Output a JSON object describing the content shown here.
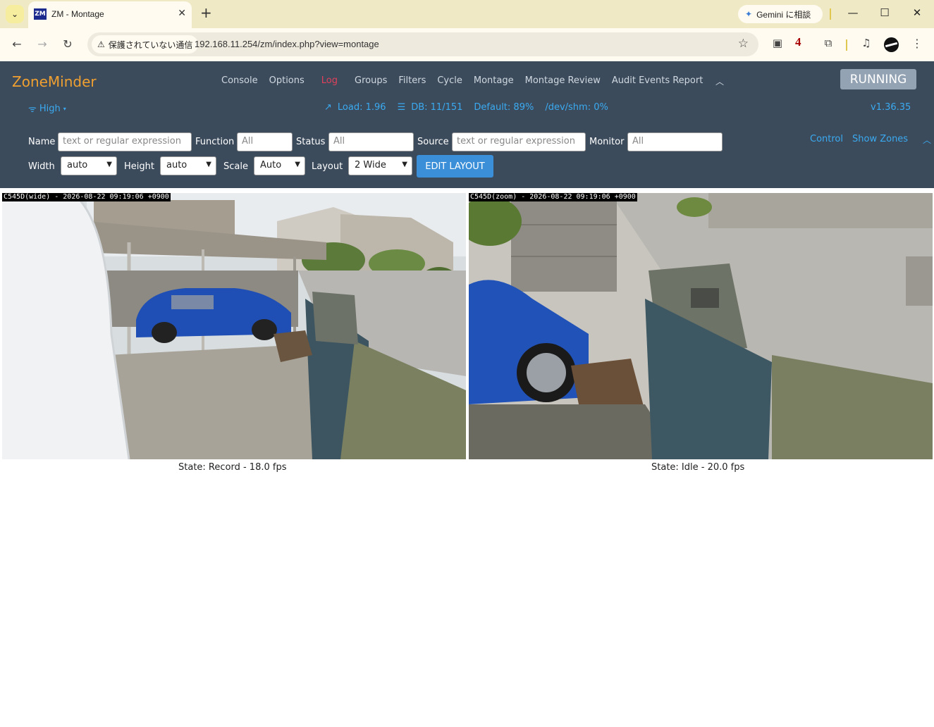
{
  "browser": {
    "tab_title": "ZM - Montage",
    "tab_favicon": "ZM",
    "gemini_label": "Gemini に相談",
    "security_label": "保護されていない通信",
    "url": "192.168.11.254/zm/index.php?view=montage",
    "extension_badge": "4"
  },
  "zm": {
    "logo": "ZoneMinder",
    "nav": [
      "Console",
      "Options",
      "Log",
      "Groups",
      "Filters",
      "Cycle",
      "Montage",
      "Montage Review",
      "Audit Events Report"
    ],
    "status": "RUNNING",
    "bandwidth": "High",
    "load": "Load: 1.96",
    "db": "DB: 11/151",
    "default_storage": "Default: 89%",
    "shm": "/dev/shm: 0%",
    "version": "v1.36.35"
  },
  "filters": {
    "name_label": "Name",
    "name_placeholder": "text or regular expression",
    "function_label": "Function",
    "function_value": "All",
    "status_label": "Status",
    "status_value": "All",
    "source_label": "Source",
    "source_placeholder": "text or regular expression",
    "monitor_label": "Monitor",
    "monitor_value": "All",
    "width_label": "Width",
    "width_value": "auto",
    "height_label": "Height",
    "height_value": "auto",
    "scale_label": "Scale",
    "scale_value": "Auto",
    "layout_label": "Layout",
    "layout_value": "2 Wide",
    "edit_layout": "EDIT LAYOUT",
    "control_link": "Control",
    "show_zones_link": "Show Zones"
  },
  "monitors": [
    {
      "stamp": "C545D(wide) - 2026-08-22 09:19:06 +0900",
      "state": "State: Record - 18.0 fps"
    },
    {
      "stamp": "C545D(zoom) - 2026-08-22 09:19:06 +0900",
      "state": "State: Idle - 20.0 fps"
    }
  ]
}
